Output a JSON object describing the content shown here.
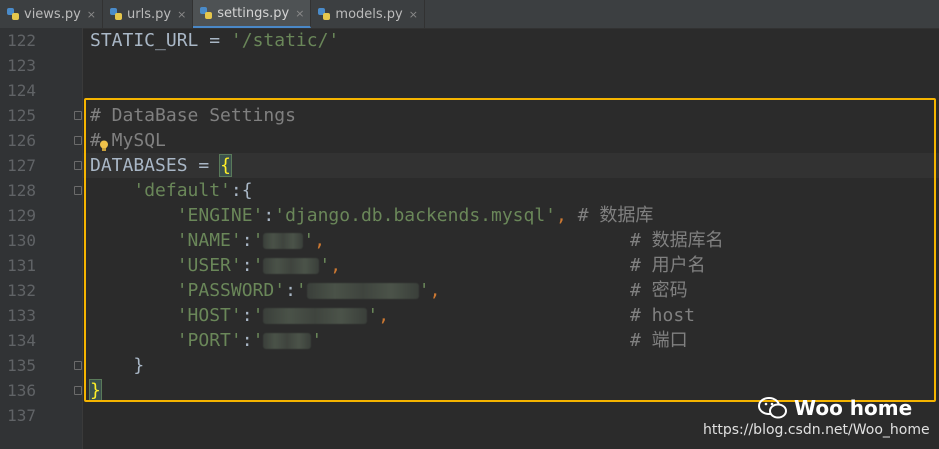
{
  "tabs": [
    {
      "label": "views.py",
      "active": false
    },
    {
      "label": "urls.py",
      "active": false
    },
    {
      "label": "settings.py",
      "active": true
    },
    {
      "label": "models.py",
      "active": false
    }
  ],
  "tab_close_glyph": "×",
  "line_numbers": [
    "122",
    "123",
    "124",
    "125",
    "126",
    "127",
    "128",
    "129",
    "130",
    "131",
    "132",
    "133",
    "134",
    "135",
    "136",
    "137"
  ],
  "code": {
    "l122": {
      "name": "STATIC_URL",
      "op": " = ",
      "value": "'/static/'"
    },
    "l125": "# DataBase Settings",
    "l126_hash": "#",
    "l126_text": " MySQL",
    "l127": {
      "name": "DATABASES",
      "op": " = ",
      "brace": "{"
    },
    "l128": {
      "key": "'default'",
      "rest": ":{"
    },
    "l129": {
      "key": "'ENGINE'",
      "colon": ":",
      "value": "'django.db.backends.mysql'",
      "comma": ",",
      "comment": " # 数据库"
    },
    "l130": {
      "key": "'NAME'",
      "colon": ":",
      "open": "'",
      "close": "'",
      "comma": ",",
      "comment": "# 数据库名"
    },
    "l131": {
      "key": "'USER'",
      "colon": ":",
      "open": "'",
      "close": "'",
      "comma": ",",
      "comment": "# 用户名"
    },
    "l132": {
      "key": "'PASSWORD'",
      "colon": ":",
      "open": "'",
      "close": "'",
      "comma": ",",
      "comment": "# 密码"
    },
    "l133": {
      "key": "'HOST'",
      "colon": ":",
      "open": "'",
      "close": "'",
      "comma": ",",
      "comment": "# host"
    },
    "l134": {
      "key": "'PORT'",
      "colon": ":",
      "open": "'",
      "close": "'",
      "comment": "# 端口"
    },
    "l135": "}",
    "l136": "}"
  },
  "watermark": {
    "name": "Woo home",
    "url": "https://blog.csdn.net/Woo_home"
  },
  "colors": {
    "highlight_box": "#f5b400",
    "string": "#6a8759",
    "comment": "#808080",
    "keyword": "#cc7832"
  }
}
